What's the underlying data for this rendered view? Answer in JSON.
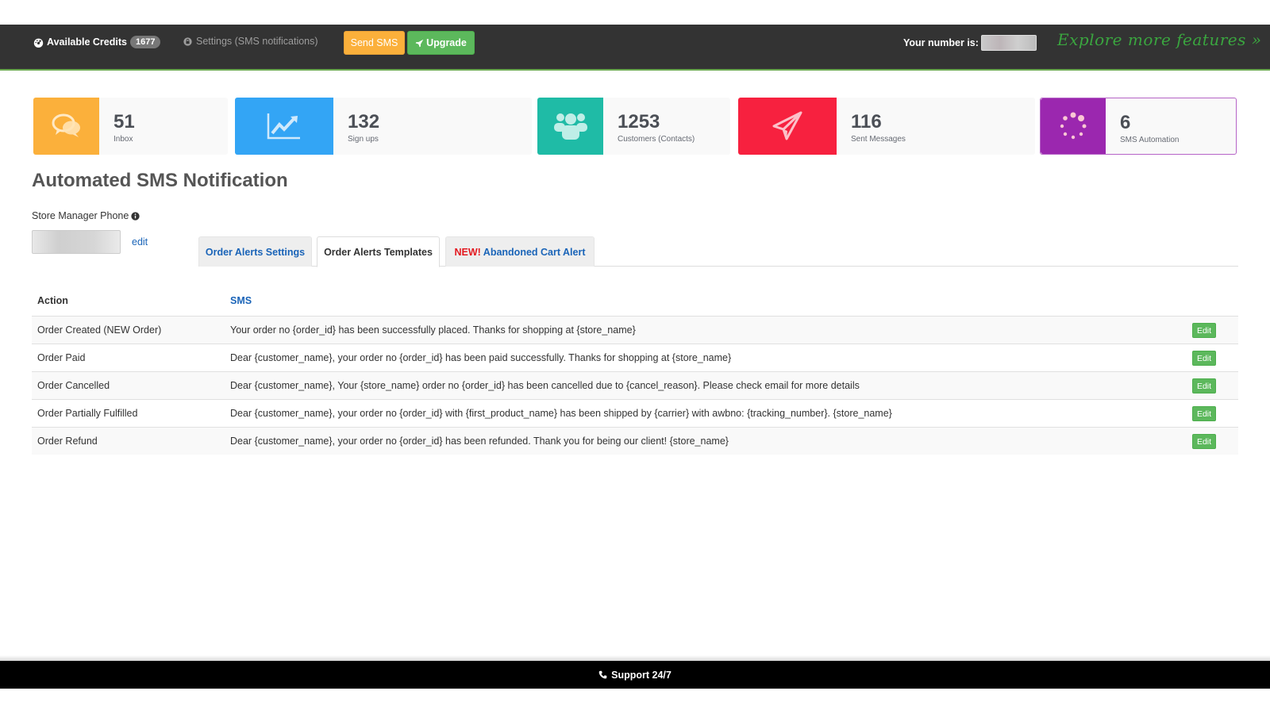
{
  "navbar": {
    "credits_label": "Available Credits",
    "credits_value": "1677",
    "settings_label": "Settings (SMS notifications)",
    "send_sms_label": "Send SMS",
    "upgrade_label": "Upgrade",
    "number_label": "Your number is:",
    "explore_label": "Explore more features »",
    "colors": {
      "background": "#333333",
      "send_sms": "#fbb03b",
      "upgrade": "#5cb85c",
      "explore": "#3aa53f"
    }
  },
  "stats": [
    {
      "value": "51",
      "label": "Inbox",
      "icon": "chat-bubbles-icon",
      "color": "#fbb03b"
    },
    {
      "value": "132",
      "label": "Sign ups",
      "icon": "line-chart-icon",
      "color": "#33a5f5"
    },
    {
      "value": "1253",
      "label": "Customers (Contacts)",
      "icon": "users-icon",
      "color": "#1fbba6"
    },
    {
      "value": "116",
      "label": "Sent Messages",
      "icon": "paper-plane-icon",
      "color": "#f7213f"
    },
    {
      "value": "6",
      "label": "SMS Automation",
      "icon": "spinner-icon",
      "color": "#9b27af"
    }
  ],
  "page": {
    "title": "Automated SMS Notification",
    "phone_label": "Store Manager Phone",
    "phone_edit": "edit"
  },
  "tabs": [
    {
      "label": "Order Alerts Settings",
      "active": false
    },
    {
      "label": "Order Alerts Templates",
      "active": true
    },
    {
      "prefix": "NEW!",
      "label": "Abandoned Cart Alert",
      "active": false
    }
  ],
  "table": {
    "headers": {
      "action": "Action",
      "sms": "SMS"
    },
    "edit_label": "Edit",
    "rows": [
      {
        "action": "Order Created (NEW Order)",
        "sms": "Your order no {order_id} has been successfully placed. Thanks for shopping at {store_name}"
      },
      {
        "action": "Order Paid",
        "sms": "Dear {customer_name}, your order no {order_id} has been paid successfully. Thanks for shopping at {store_name}"
      },
      {
        "action": "Order Cancelled",
        "sms": "Dear {customer_name}, Your {store_name} order no {order_id} has been cancelled due to {cancel_reason}. Please check email for more details"
      },
      {
        "action": "Order Partially Fulfilled",
        "sms": "Dear {customer_name}, your order no {order_id} with {first_product_name} has been shipped by {carrier} with awbno: {tracking_number}. {store_name}"
      },
      {
        "action": "Order Refund",
        "sms": "Dear {customer_name}, your order no {order_id} has been refunded. Thank you for being our client! {store_name}"
      }
    ]
  },
  "footer": {
    "label": "Support 24/7"
  }
}
